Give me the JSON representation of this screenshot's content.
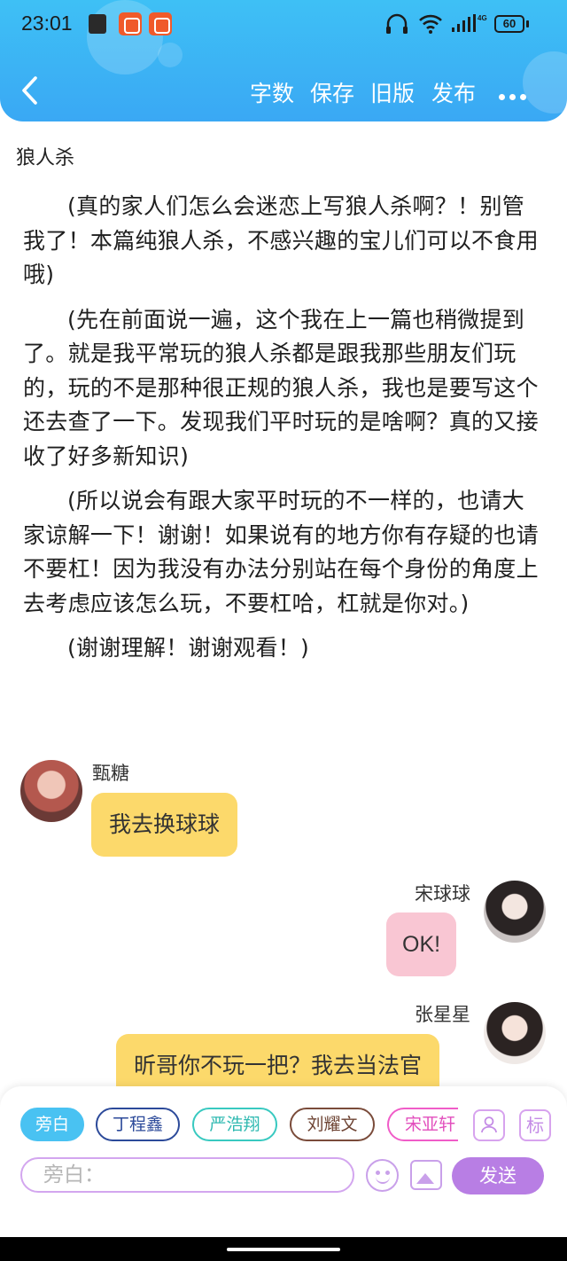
{
  "status_bar": {
    "time": "23:01",
    "battery": "60",
    "network": "4G"
  },
  "toolbar": {
    "word_count_label": "字数",
    "save_label": "保存",
    "old_version_label": "旧版",
    "publish_label": "发布"
  },
  "document": {
    "title": "狼人杀",
    "paragraphs": [
      "(真的家人们怎么会迷恋上写狼人杀啊？！别管我了！本篇纯狼人杀，不感兴趣的宝儿们可以不食用哦)",
      "(先在前面说一遍，这个我在上一篇也稍微提到了。就是我平常玩的狼人杀都是跟我那些朋友们玩的，玩的不是那种很正规的狼人杀，我也是要写这个还去查了一下。发现我们平时玩的是啥啊？真的又接收了好多新知识)",
      "(所以说会有跟大家平时玩的不一样的，也请大家谅解一下！谢谢！如果说有的地方你有存疑的也请不要杠！因为我没有办法分别站在每个身份的角度上去考虑应该怎么玩，不要杠哈，杠就是你对。)",
      "(谢谢理解！谢谢观看！)"
    ]
  },
  "messages": [
    {
      "sender": "甄糖",
      "text": "我去换球球",
      "color": "#fcd96b"
    },
    {
      "sender": "宋球球",
      "text": "OK!",
      "color": "#f9c6d3"
    },
    {
      "sender": "张星星",
      "text": "昕哥你不玩一把？我去当法官",
      "color": "#fcd96b"
    }
  ],
  "roles": [
    {
      "label": "旁白",
      "color": "#49c2f2"
    },
    {
      "label": "丁程鑫",
      "color": "#2c4a9a"
    },
    {
      "label": "严浩翔",
      "color": "#38c9c0"
    },
    {
      "label": "刘耀文",
      "color": "#7a4b3a"
    },
    {
      "label": "宋亚轩",
      "color": "#f05cc8"
    }
  ],
  "composer": {
    "tag_label": "标",
    "placeholder": "旁白：",
    "send_label": "发送"
  },
  "icons": [
    "back-arrow-icon",
    "more-icon",
    "role-manage-icon",
    "tag-icon",
    "emoji-icon",
    "image-icon"
  ]
}
